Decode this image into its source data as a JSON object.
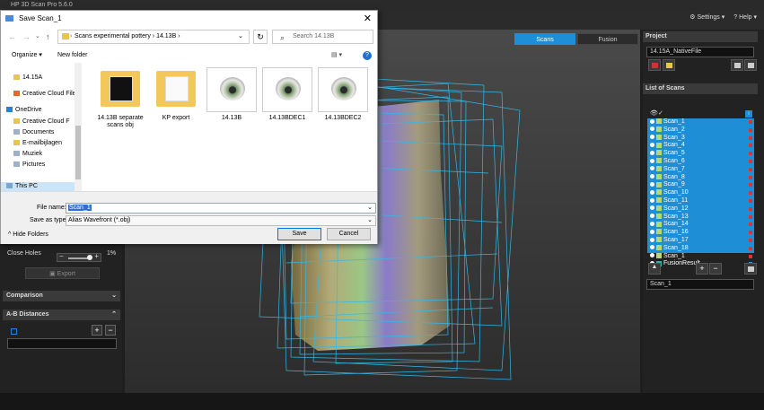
{
  "app": {
    "title": "HP 3D Scan Pro 5.6.0",
    "settings_label": "Settings",
    "help_label": "Help"
  },
  "view_tabs": [
    "Scans",
    "Fusion"
  ],
  "left_panel": {
    "close_holes_label": "Close Holes",
    "close_holes_value": "1%",
    "close_holes_fraction": 0.25,
    "export_label": "Export",
    "comparison_label": "Comparison",
    "ab_label": "A-B Distances"
  },
  "right_panel": {
    "project_label": "Project",
    "project_name": "14.15A_NativeFile",
    "list_label": "List of Scans",
    "scans": [
      "Scan_1",
      "Scan_2",
      "Scan_3",
      "Scan_4",
      "Scan_5",
      "Scan_6",
      "Scan_7",
      "Scan_8",
      "Scan_9",
      "Scan_10",
      "Scan_11",
      "Scan_12",
      "Scan_13",
      "Scan_14",
      "Scan_16",
      "Scan_17",
      "Scan_18",
      "Scan_1"
    ],
    "fusion_result": "FusionResult",
    "selected_scan_name": "Scan_1"
  },
  "dialog": {
    "title": "Save Scan_1",
    "breadcrumb": [
      "Scans experimental pottery",
      "14.13B"
    ],
    "search_placeholder": "Search 14.13B",
    "organize_label": "Organize",
    "new_folder_label": "New folder",
    "nav_items": [
      {
        "label": "14.15A",
        "icon": "folder-icon",
        "color": "#e8c453"
      },
      {
        "label": "Creative Cloud Files",
        "icon": "cloud-icon",
        "color": "#e06a2a"
      },
      {
        "label": "OneDrive",
        "icon": "onedrive-icon",
        "color": "#2c7fd6"
      },
      {
        "label": "Creative Cloud F",
        "icon": "folder-icon",
        "color": "#e8c453"
      },
      {
        "label": "Documents",
        "icon": "documents-icon",
        "color": "#9fb1c7"
      },
      {
        "label": "E-mailbijlagen",
        "icon": "folder-icon",
        "color": "#e8c453"
      },
      {
        "label": "Muziek",
        "icon": "music-icon",
        "color": "#9fb1c7"
      },
      {
        "label": "Pictures",
        "icon": "pictures-icon",
        "color": "#9fb1c7"
      },
      {
        "label": "This PC",
        "icon": "pc-icon",
        "color": "#7aa6d6"
      }
    ],
    "files": [
      {
        "name": "14.13B separate scans obj",
        "kind": "folder-dark"
      },
      {
        "name": "KP export",
        "kind": "folder"
      },
      {
        "name": "14.13B",
        "kind": "eye"
      },
      {
        "name": "14.13BDEC1",
        "kind": "eye"
      },
      {
        "name": "14.13BDEC2",
        "kind": "eye"
      }
    ],
    "file_name_label": "File name:",
    "file_name_value": "Scan_1",
    "save_as_label": "Save as type:",
    "save_as_value": "Alias Wavefront (*.obj)",
    "hide_folders_label": "Hide Folders",
    "save_label": "Save",
    "cancel_label": "Cancel"
  }
}
